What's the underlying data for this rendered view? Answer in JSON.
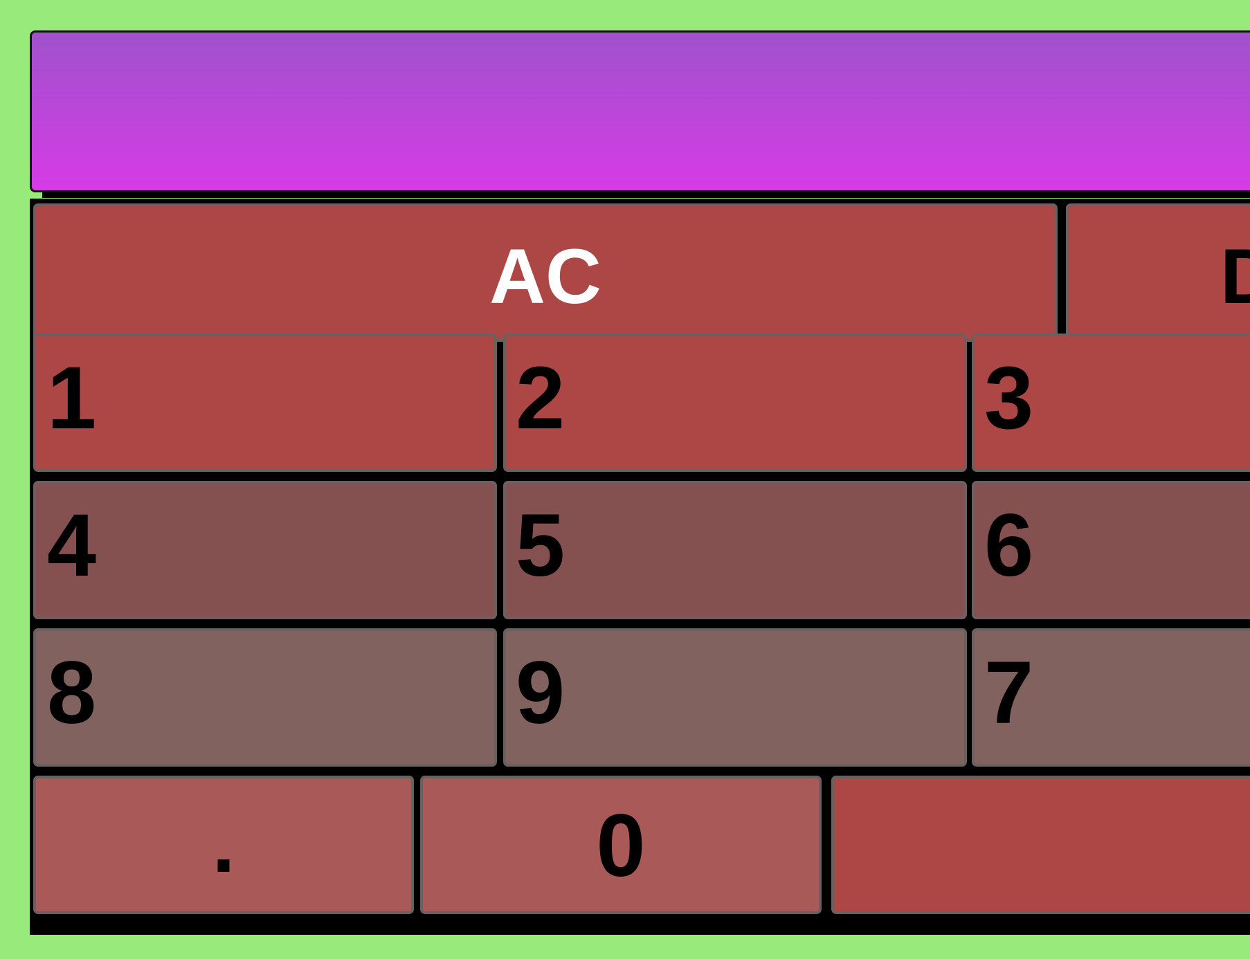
{
  "display": {
    "value": ""
  },
  "keys": {
    "ac": "AC",
    "del": "D",
    "one": "1",
    "two": "2",
    "three": "3",
    "four": "4",
    "five": "5",
    "six": "6",
    "eight": "8",
    "nine": "9",
    "seven": "7",
    "dot": ".",
    "zero": "0",
    "blank": ""
  },
  "colors": {
    "background": "#98ea7a",
    "display_top": "#a052cc",
    "display_bottom": "#d63be6",
    "row_red": "#ad4745",
    "row_mid": "#855150",
    "row_grey": "#82625f",
    "row_bottom": "#a95a58",
    "key_border": "#6a6060"
  }
}
